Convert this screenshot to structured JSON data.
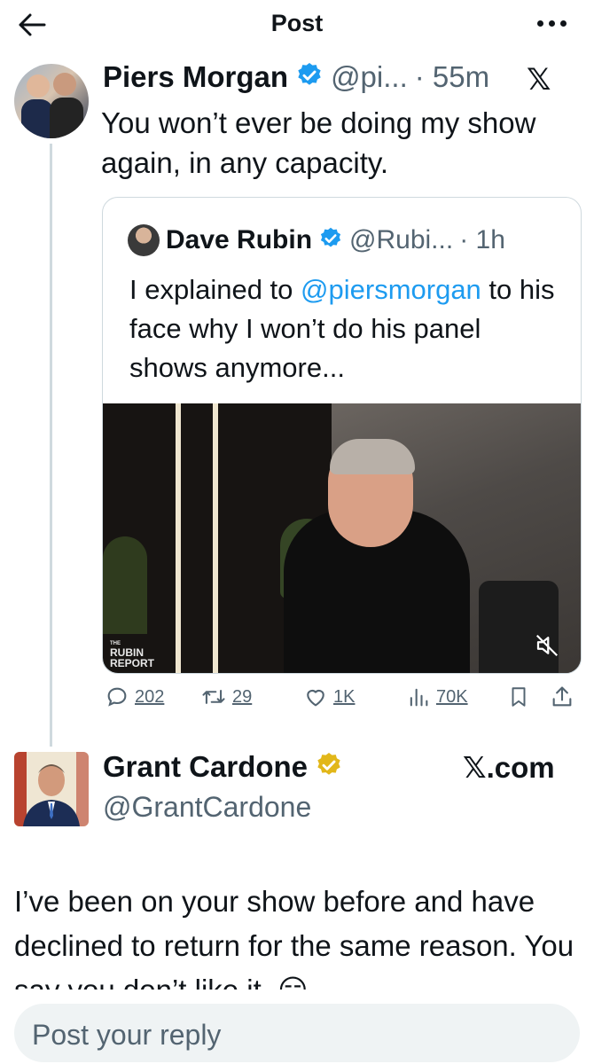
{
  "header": {
    "title": "Post"
  },
  "main_post": {
    "name": "Piers Morgan",
    "handle": "@pi...",
    "time": "· 55m",
    "text": "You won’t ever be doing my show again, in any capacity."
  },
  "quoted_post": {
    "name": "Dave Rubin",
    "handle": "@Rubi...",
    "time": "· 1h",
    "text_before": "I explained to ",
    "mention": "@piersmorgan",
    "text_after": " to his face why I won’t do his panel shows anymore...",
    "video_logo_small": "THE",
    "video_logo_line1": "RUBIN",
    "video_logo_line2": "REPORT"
  },
  "actions": {
    "replies": "202",
    "reposts": "29",
    "likes": "1K",
    "views": "70K"
  },
  "reply_post": {
    "name": "Grant Cardone",
    "handle": "@GrantCardone",
    "source": "𝕏.com",
    "text": "I’ve been on your show before and have declined to return for the same reason. You say you don’t like it. 😏"
  },
  "reply_bar": {
    "placeholder": "Post your reply"
  },
  "colors": {
    "accent": "#1d9bf0",
    "gold_badge": "#e2b719",
    "muted": "#536471"
  }
}
